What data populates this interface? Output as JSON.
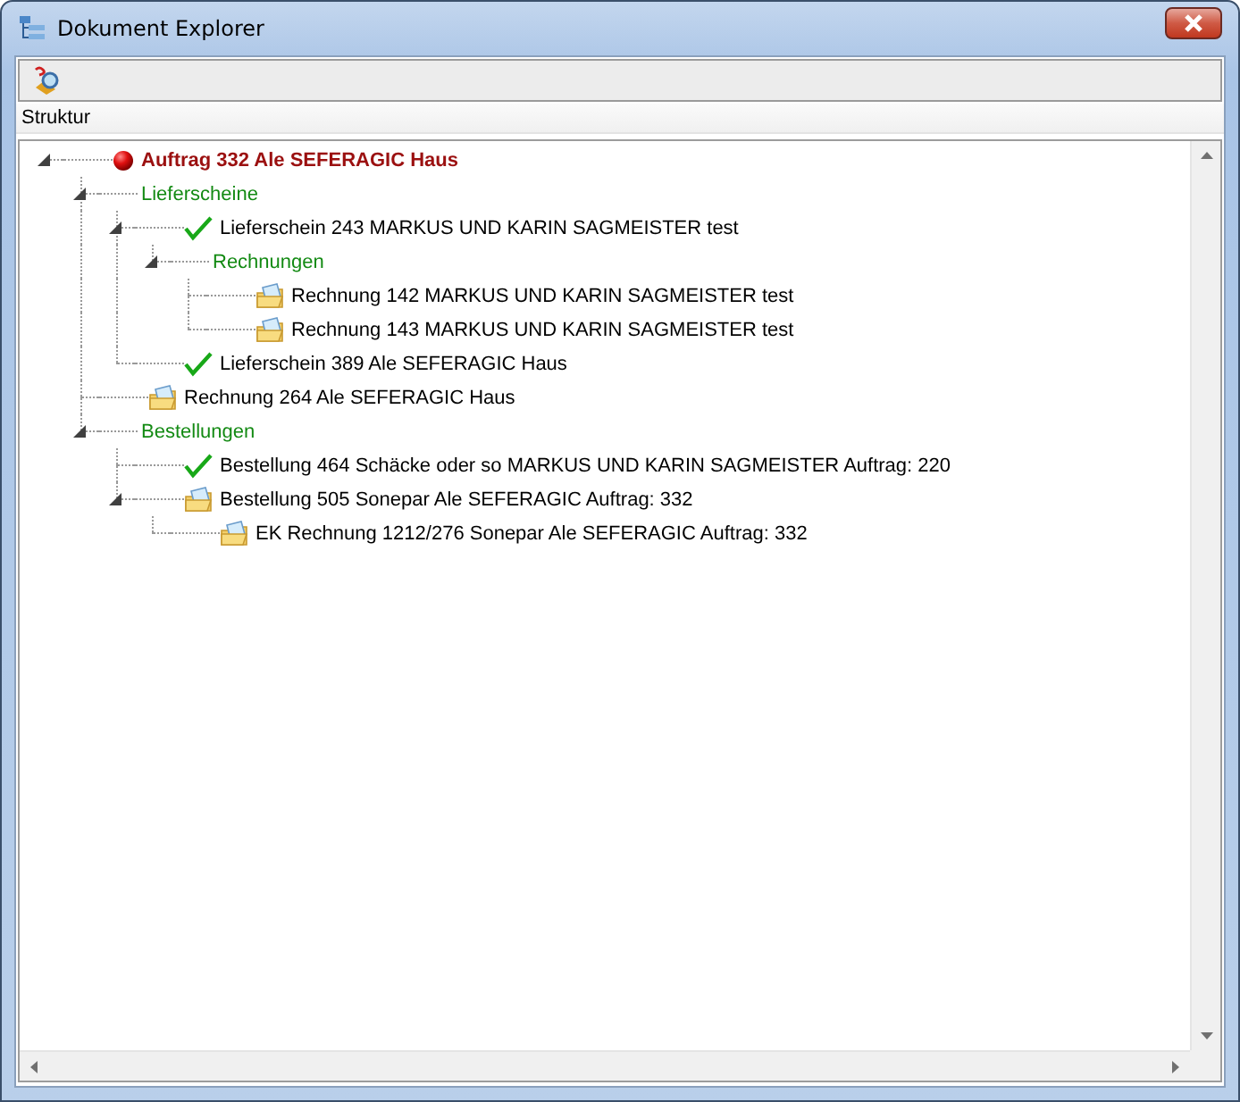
{
  "window": {
    "title": "Dokument Explorer"
  },
  "tree": {
    "header": "Struktur",
    "nodes": [
      {
        "label": "Auftrag 332 Ale SEFERAGIC Haus",
        "kind": "order",
        "expanded": true,
        "children": [
          {
            "label": "Lieferscheine",
            "kind": "group",
            "expanded": true,
            "children": [
              {
                "label": "Lieferschein 243 MARKUS UND KARIN SAGMEISTER test",
                "kind": "done",
                "expanded": true,
                "children": [
                  {
                    "label": "Rechnungen",
                    "kind": "group",
                    "expanded": true,
                    "children": [
                      {
                        "label": "Rechnung 142 MARKUS UND KARIN SAGMEISTER test",
                        "kind": "document"
                      },
                      {
                        "label": "Rechnung 143 MARKUS UND KARIN SAGMEISTER test",
                        "kind": "document"
                      }
                    ]
                  }
                ]
              },
              {
                "label": "Lieferschein 389 Ale SEFERAGIC Haus",
                "kind": "done"
              }
            ]
          },
          {
            "label": "Rechnung 264 Ale SEFERAGIC Haus",
            "kind": "document"
          },
          {
            "label": "Bestellungen",
            "kind": "group",
            "expanded": true,
            "children": [
              {
                "label": "Bestellung 464 Schäcke oder so MARKUS UND KARIN SAGMEISTER Auftrag: 220",
                "kind": "done"
              },
              {
                "label": "Bestellung 505 Sonepar Ale SEFERAGIC Auftrag: 332",
                "kind": "document",
                "expanded": true,
                "children": [
                  {
                    "label": "EK Rechnung 1212/276 Sonepar Ale SEFERAGIC Auftrag: 332",
                    "kind": "document"
                  }
                ]
              }
            ]
          }
        ]
      }
    ]
  }
}
